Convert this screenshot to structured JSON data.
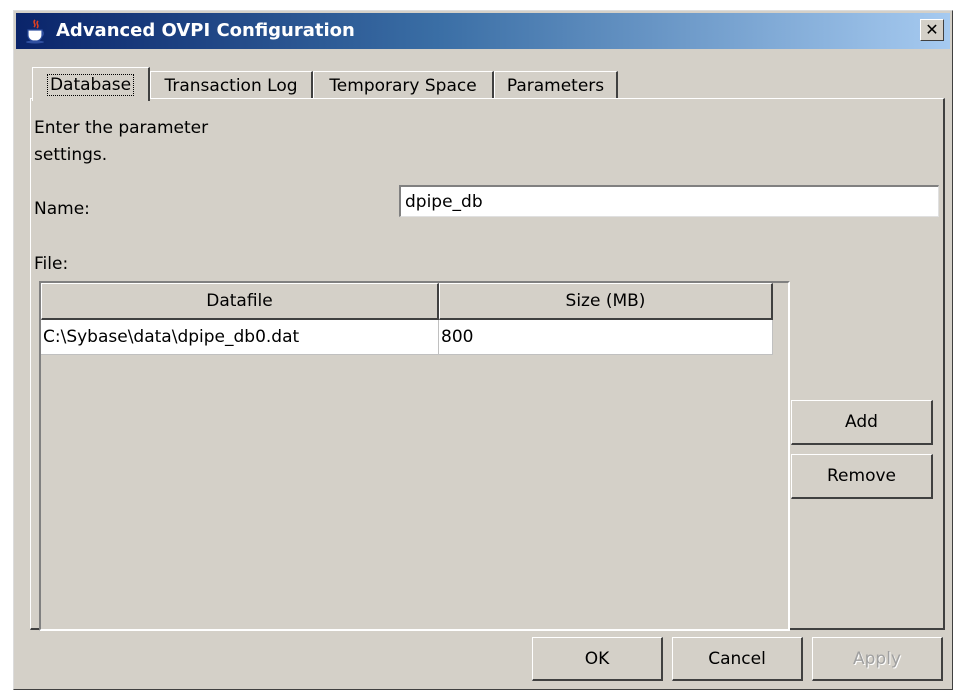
{
  "window": {
    "title": "Advanced OVPI Configuration",
    "close_symbol": "✕"
  },
  "tabs": [
    {
      "label": "Database"
    },
    {
      "label": "Transaction Log"
    },
    {
      "label": "Temporary Space"
    },
    {
      "label": "Parameters"
    }
  ],
  "panel": {
    "instructions": "Enter the parameter settings.",
    "name_label": "Name:",
    "name_value": "dpipe_db",
    "file_label": "File:"
  },
  "table": {
    "columns": [
      "Datafile",
      "Size (MB)"
    ],
    "rows": [
      {
        "datafile": "C:\\Sybase\\data\\dpipe_db0.dat",
        "size": "800"
      }
    ]
  },
  "side_buttons": {
    "add": "Add",
    "remove": "Remove"
  },
  "footer": {
    "ok": "OK",
    "cancel": "Cancel",
    "apply": "Apply"
  },
  "icons": {
    "app": "java-cup-icon",
    "close": "close-icon"
  }
}
